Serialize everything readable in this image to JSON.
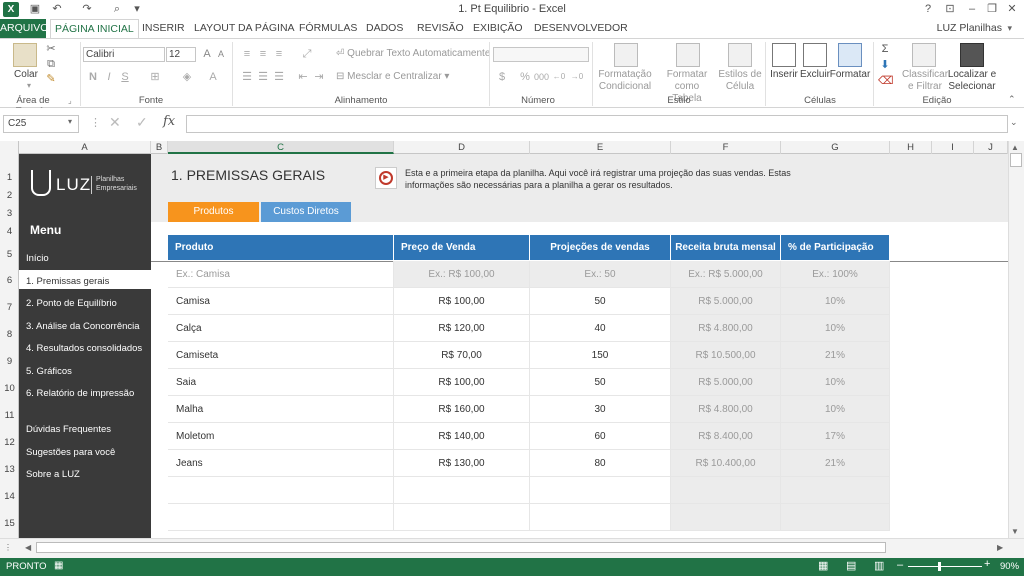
{
  "window": {
    "title": "1. Pt Equilibrio - Excel",
    "user": "LUZ Planilhas",
    "help": "?",
    "minimize": "–",
    "restore": "❐",
    "close": "✕",
    "ribbon_opts": "⊡"
  },
  "tabs": [
    "ARQUIVO",
    "PÁGINA INICIAL",
    "INSERIR",
    "LAYOUT DA PÁGINA",
    "FÓRMULAS",
    "DADOS",
    "REVISÃO",
    "EXIBIÇÃO",
    "DESENVOLVEDOR"
  ],
  "ribbon": {
    "clipboard": {
      "label": "Área de Transf...",
      "paste": "Colar"
    },
    "font": {
      "label": "Fonte",
      "family": "Calibri",
      "size": "12",
      "bold": "N",
      "italic": "I",
      "underline": "S"
    },
    "alignment": {
      "label": "Alinhamento",
      "wrap": "Quebrar Texto Automaticamente",
      "merge": "Mesclar e Centralizar"
    },
    "number": {
      "label": "Número",
      "format": ""
    },
    "styles": {
      "label": "Estilo",
      "cond1": "Formatação",
      "cond2": "Condicional",
      "table1": "Formatar como",
      "table2": "Tabela",
      "cell1": "Estilos de",
      "cell2": "Célula"
    },
    "cells": {
      "label": "Células",
      "insert": "Inserir",
      "delete": "Excluir",
      "format": "Formatar"
    },
    "editing": {
      "label": "Edição",
      "sort1": "Classificar",
      "sort2": "e Filtrar",
      "find1": "Localizar e",
      "find2": "Selecionar"
    }
  },
  "formula_bar": {
    "name_box": "C25",
    "fx": "fx",
    "value": ""
  },
  "columns": [
    "A",
    "B",
    "C",
    "D",
    "E",
    "F",
    "G",
    "H",
    "I",
    "J"
  ],
  "rows": [
    "1",
    "2",
    "3",
    "4",
    "5",
    "6",
    "7",
    "8",
    "9",
    "10",
    "11",
    "12",
    "13",
    "14",
    "15"
  ],
  "sidebar": {
    "logo": "LUZ",
    "logo_sub1": "Planilhas",
    "logo_sub2": "Empresariais",
    "menu": "Menu",
    "items": [
      "Início",
      "1. Premissas gerais",
      "2. Ponto de Equilíbrio",
      "3. Análise da Concorrência",
      "4. Resultados consolidados",
      "5. Gráficos",
      "6. Relatório de impressão"
    ],
    "links": [
      "Dúvidas Frequentes",
      "Sugestões para você",
      "Sobre a LUZ"
    ]
  },
  "page": {
    "title": "1. PREMISSAS GERAIS",
    "info": "Esta e a primeira etapa da planilha. Aqui você irá registrar uma projeção das suas vendas. Estas informações são necessárias para a planilha a gerar os resultados.",
    "tab_products": "Produtos",
    "tab_costs": "Custos Diretos",
    "accent": "#f7941d",
    "tab2_color": "#5b9bd5",
    "header_color": "#2e75b6"
  },
  "table": {
    "headers": [
      "Produto",
      "Preço de Venda",
      "Projeções de vendas mensais",
      "Receita bruta mensal",
      "% de Participação"
    ],
    "example": [
      "Ex.: Camisa",
      "Ex.: R$ 100,00",
      "Ex.: 50",
      "Ex.: R$ 5.000,00",
      "Ex.: 100%"
    ],
    "rows": [
      [
        "Camisa",
        "R$ 100,00",
        "50",
        "R$ 5.000,00",
        "10%"
      ],
      [
        "Calça",
        "R$ 120,00",
        "40",
        "R$ 4.800,00",
        "10%"
      ],
      [
        "Camiseta",
        "R$ 70,00",
        "150",
        "R$ 10.500,00",
        "21%"
      ],
      [
        "Saia",
        "R$ 100,00",
        "50",
        "R$ 5.000,00",
        "10%"
      ],
      [
        "Malha",
        "R$ 160,00",
        "30",
        "R$ 4.800,00",
        "10%"
      ],
      [
        "Moletom",
        "R$ 140,00",
        "60",
        "R$ 8.400,00",
        "17%"
      ],
      [
        "Jeans",
        "R$ 130,00",
        "80",
        "R$ 10.400,00",
        "21%"
      ]
    ]
  },
  "status": {
    "mode": "PRONTO",
    "zoom": "90%",
    "minus": "–",
    "plus": "+"
  }
}
